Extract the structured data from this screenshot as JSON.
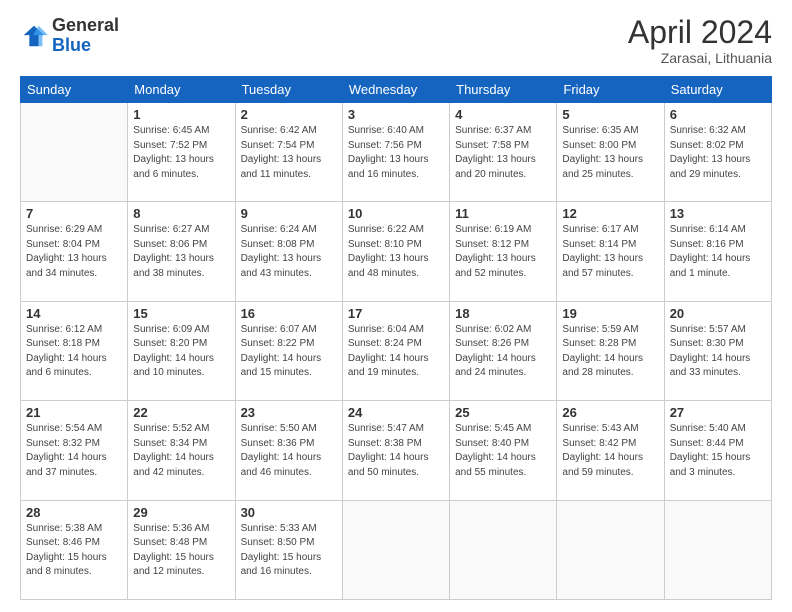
{
  "logo": {
    "line1": "General",
    "line2": "Blue"
  },
  "header": {
    "title": "April 2024",
    "subtitle": "Zarasai, Lithuania"
  },
  "weekdays": [
    "Sunday",
    "Monday",
    "Tuesday",
    "Wednesday",
    "Thursday",
    "Friday",
    "Saturday"
  ],
  "weeks": [
    [
      {
        "day": "",
        "info": ""
      },
      {
        "day": "1",
        "info": "Sunrise: 6:45 AM\nSunset: 7:52 PM\nDaylight: 13 hours\nand 6 minutes."
      },
      {
        "day": "2",
        "info": "Sunrise: 6:42 AM\nSunset: 7:54 PM\nDaylight: 13 hours\nand 11 minutes."
      },
      {
        "day": "3",
        "info": "Sunrise: 6:40 AM\nSunset: 7:56 PM\nDaylight: 13 hours\nand 16 minutes."
      },
      {
        "day": "4",
        "info": "Sunrise: 6:37 AM\nSunset: 7:58 PM\nDaylight: 13 hours\nand 20 minutes."
      },
      {
        "day": "5",
        "info": "Sunrise: 6:35 AM\nSunset: 8:00 PM\nDaylight: 13 hours\nand 25 minutes."
      },
      {
        "day": "6",
        "info": "Sunrise: 6:32 AM\nSunset: 8:02 PM\nDaylight: 13 hours\nand 29 minutes."
      }
    ],
    [
      {
        "day": "7",
        "info": "Sunrise: 6:29 AM\nSunset: 8:04 PM\nDaylight: 13 hours\nand 34 minutes."
      },
      {
        "day": "8",
        "info": "Sunrise: 6:27 AM\nSunset: 8:06 PM\nDaylight: 13 hours\nand 38 minutes."
      },
      {
        "day": "9",
        "info": "Sunrise: 6:24 AM\nSunset: 8:08 PM\nDaylight: 13 hours\nand 43 minutes."
      },
      {
        "day": "10",
        "info": "Sunrise: 6:22 AM\nSunset: 8:10 PM\nDaylight: 13 hours\nand 48 minutes."
      },
      {
        "day": "11",
        "info": "Sunrise: 6:19 AM\nSunset: 8:12 PM\nDaylight: 13 hours\nand 52 minutes."
      },
      {
        "day": "12",
        "info": "Sunrise: 6:17 AM\nSunset: 8:14 PM\nDaylight: 13 hours\nand 57 minutes."
      },
      {
        "day": "13",
        "info": "Sunrise: 6:14 AM\nSunset: 8:16 PM\nDaylight: 14 hours\nand 1 minute."
      }
    ],
    [
      {
        "day": "14",
        "info": "Sunrise: 6:12 AM\nSunset: 8:18 PM\nDaylight: 14 hours\nand 6 minutes."
      },
      {
        "day": "15",
        "info": "Sunrise: 6:09 AM\nSunset: 8:20 PM\nDaylight: 14 hours\nand 10 minutes."
      },
      {
        "day": "16",
        "info": "Sunrise: 6:07 AM\nSunset: 8:22 PM\nDaylight: 14 hours\nand 15 minutes."
      },
      {
        "day": "17",
        "info": "Sunrise: 6:04 AM\nSunset: 8:24 PM\nDaylight: 14 hours\nand 19 minutes."
      },
      {
        "day": "18",
        "info": "Sunrise: 6:02 AM\nSunset: 8:26 PM\nDaylight: 14 hours\nand 24 minutes."
      },
      {
        "day": "19",
        "info": "Sunrise: 5:59 AM\nSunset: 8:28 PM\nDaylight: 14 hours\nand 28 minutes."
      },
      {
        "day": "20",
        "info": "Sunrise: 5:57 AM\nSunset: 8:30 PM\nDaylight: 14 hours\nand 33 minutes."
      }
    ],
    [
      {
        "day": "21",
        "info": "Sunrise: 5:54 AM\nSunset: 8:32 PM\nDaylight: 14 hours\nand 37 minutes."
      },
      {
        "day": "22",
        "info": "Sunrise: 5:52 AM\nSunset: 8:34 PM\nDaylight: 14 hours\nand 42 minutes."
      },
      {
        "day": "23",
        "info": "Sunrise: 5:50 AM\nSunset: 8:36 PM\nDaylight: 14 hours\nand 46 minutes."
      },
      {
        "day": "24",
        "info": "Sunrise: 5:47 AM\nSunset: 8:38 PM\nDaylight: 14 hours\nand 50 minutes."
      },
      {
        "day": "25",
        "info": "Sunrise: 5:45 AM\nSunset: 8:40 PM\nDaylight: 14 hours\nand 55 minutes."
      },
      {
        "day": "26",
        "info": "Sunrise: 5:43 AM\nSunset: 8:42 PM\nDaylight: 14 hours\nand 59 minutes."
      },
      {
        "day": "27",
        "info": "Sunrise: 5:40 AM\nSunset: 8:44 PM\nDaylight: 15 hours\nand 3 minutes."
      }
    ],
    [
      {
        "day": "28",
        "info": "Sunrise: 5:38 AM\nSunset: 8:46 PM\nDaylight: 15 hours\nand 8 minutes."
      },
      {
        "day": "29",
        "info": "Sunrise: 5:36 AM\nSunset: 8:48 PM\nDaylight: 15 hours\nand 12 minutes."
      },
      {
        "day": "30",
        "info": "Sunrise: 5:33 AM\nSunset: 8:50 PM\nDaylight: 15 hours\nand 16 minutes."
      },
      {
        "day": "",
        "info": ""
      },
      {
        "day": "",
        "info": ""
      },
      {
        "day": "",
        "info": ""
      },
      {
        "day": "",
        "info": ""
      }
    ]
  ]
}
